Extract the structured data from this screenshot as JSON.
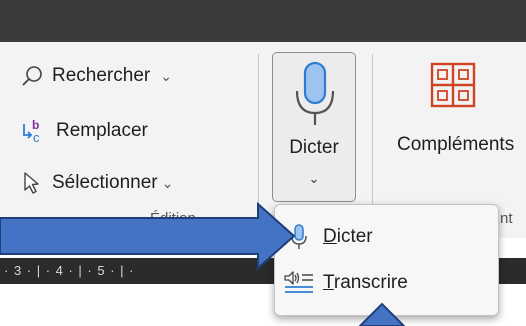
{
  "ribbon": {
    "edit_group": {
      "items": [
        {
          "label": "Rechercher",
          "icon": "search-icon",
          "caret": "⌄"
        },
        {
          "label": "Remplacer",
          "icon": "replace-icon"
        },
        {
          "label": "Sélectionner",
          "icon": "select-icon",
          "caret": "⌄"
        }
      ],
      "group_label": "Édition"
    },
    "dicter_button": {
      "label": "Dicter",
      "icon": "microphone-icon",
      "dropdown": "⌄"
    },
    "complements": {
      "label": "Compléments",
      "icon": "add-ins-icon"
    },
    "partial_label": "nt"
  },
  "dropdown_menu": {
    "items": [
      {
        "label": "Dicter",
        "accel": "D",
        "rest": "icter",
        "icon": "microphone-icon"
      },
      {
        "label": "Transcrire",
        "accel": "T",
        "rest": "ranscrire",
        "icon": "transcribe-icon"
      }
    ]
  },
  "ruler": {
    "text": "· 3 · | · 4 · | · 5 · | ·"
  },
  "colors": {
    "accent_blue": "#4472c4",
    "mic_blue": "#2f7cd3",
    "addin_red": "#d04423",
    "titlebar": "#3b3b3b",
    "ruler_bg": "#2b2b2b"
  }
}
